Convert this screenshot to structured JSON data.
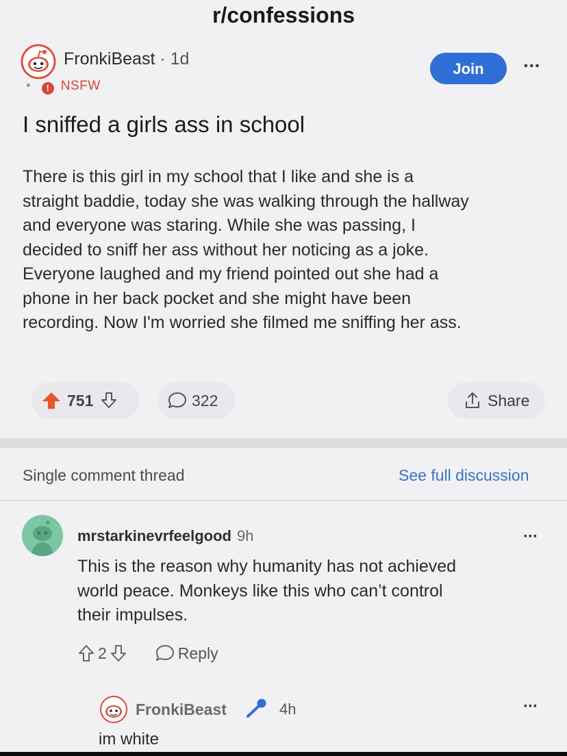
{
  "header": {
    "subreddit": "r/confessions"
  },
  "post": {
    "author": "FronkiBeast",
    "age": "1d",
    "flair": "NSFW",
    "join_label": "Join",
    "more_label": "···",
    "title": "I sniffed a girls ass in school",
    "body_lines": [
      "There is this girl in my school that I like and she is a",
      "straight baddie, today she was walking through the hallway",
      "and everyone was staring. While she was passing, I",
      "decided to sniff her ass without her noticing as a joke.",
      "Everyone laughed and my friend pointed out she had a",
      "phone in her back pocket and she might have been",
      "recording. Now I'm worried she filmed me sniffing her ass."
    ],
    "votes": "751",
    "comments": "322",
    "share_label": "Share",
    "upvoted": true
  },
  "thread": {
    "single_label": "Single comment thread",
    "see_full_label": "See full discussion"
  },
  "comment": {
    "author": "mrstarkinevrfeelgood",
    "age": "9h",
    "more_label": "···",
    "body_lines": [
      "This is the reason why humanity has not achieved",
      "world peace. Monkeys like this who can’t control",
      "their impulses."
    ],
    "votes": "2",
    "reply_label": "Reply"
  },
  "reply": {
    "author": "FronkiBeast",
    "age": "4h",
    "more_label": "···",
    "body": "im white"
  },
  "colors": {
    "accent": "#2f6ed6",
    "upvote": "#e8552f",
    "nsfw": "#d8463c",
    "link": "#3a72c8",
    "background": "#f1f1f3"
  }
}
